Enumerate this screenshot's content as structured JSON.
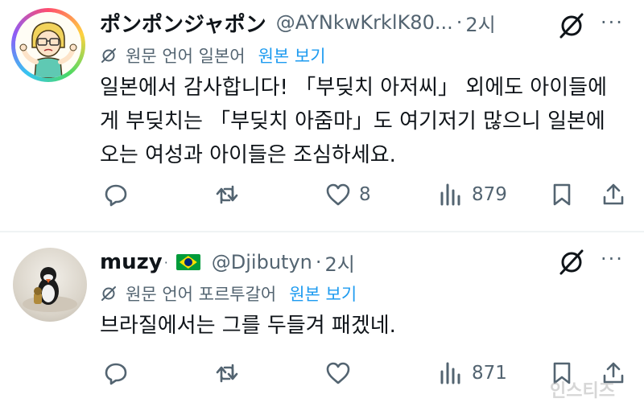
{
  "tweets": [
    {
      "name": "ポンポンジャポン",
      "handle": "@AYNkwKrklK80...",
      "dot": "·",
      "time": "2시",
      "translation": {
        "label": "원문 언어 일본어",
        "show_original": "원본 보기"
      },
      "lines": [
        "일본에서 감사합니다! 「부딪치 아저씨」 외에도 아이들에",
        "게 부딪치는 「부딪치 아줌마」도 여기저기 많으니 일본에",
        "오는 여성과 아이들은 조심하세요."
      ],
      "stats": {
        "replies": "",
        "retweets": "",
        "likes": "8",
        "views": "879"
      }
    },
    {
      "name": "muzy",
      "name_suffix": "·",
      "flag": "🇧🇷",
      "handle": "@Djibutyn",
      "dot": "·",
      "time": "2시",
      "translation": {
        "label": "원문 언어 포르투갈어",
        "show_original": "원본 보기"
      },
      "lines": [
        "브라질에서는 그를 두들겨 패겠네."
      ],
      "stats": {
        "replies": "",
        "retweets": "",
        "likes": "",
        "views": "871"
      }
    }
  ],
  "more_label": "···",
  "watermark": "인스티즈",
  "colors": {
    "text": "#0f1419",
    "secondary": "#536471",
    "link": "#1d9bf0",
    "separator": "#eff3f4"
  }
}
